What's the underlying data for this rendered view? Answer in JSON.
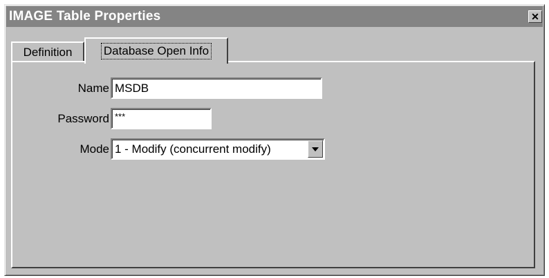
{
  "window": {
    "title": "IMAGE Table Properties",
    "close_icon": "close-icon",
    "close_glyph": "✕"
  },
  "tabs": [
    {
      "label": "Definition",
      "active": false
    },
    {
      "label": "Database Open Info",
      "active": true
    }
  ],
  "form": {
    "name": {
      "label": "Name",
      "value": "MSDB"
    },
    "password": {
      "label": "Password",
      "value": "***"
    },
    "mode": {
      "label": "Mode",
      "value": "1 - Modify (concurrent modify)",
      "dropdown_icon": "chevron-down-icon"
    }
  },
  "colors": {
    "titlebar": "#848484",
    "face": "#c0c0c0",
    "field": "#ffffff"
  }
}
